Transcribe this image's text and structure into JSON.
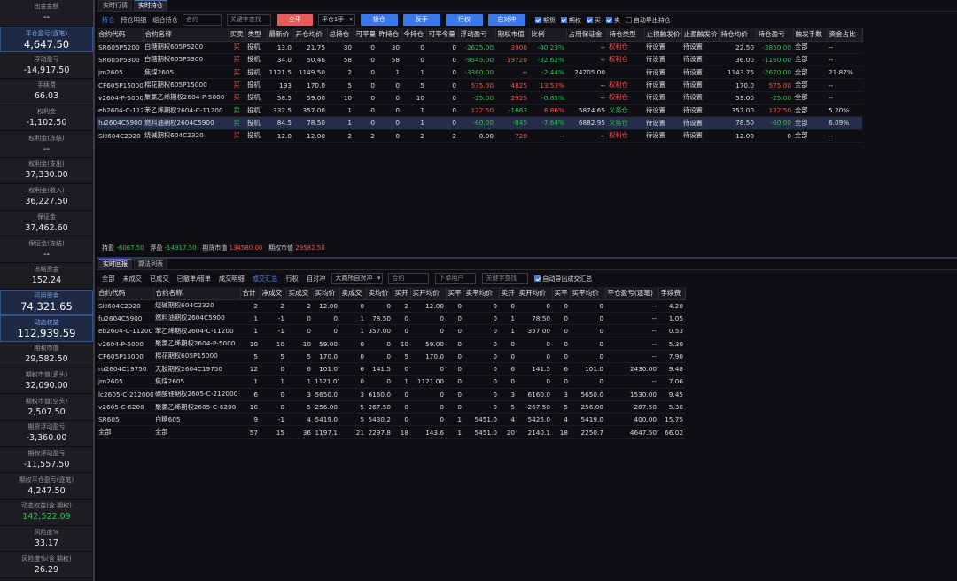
{
  "sidebar": [
    {
      "label": "出金金额",
      "value": "--",
      "hl": false,
      "color": ""
    },
    {
      "label": "平仓盈亏(逐笔)",
      "value": "4,647.50",
      "hl": true,
      "color": ""
    },
    {
      "label": "浮动盈亏",
      "value": "-14,917.50",
      "hl": false,
      "color": ""
    },
    {
      "label": "手续费",
      "value": "66.03",
      "hl": false,
      "color": ""
    },
    {
      "label": "权利金",
      "value": "-1,102.50",
      "hl": false,
      "color": ""
    },
    {
      "label": "权利金(冻结)",
      "value": "--",
      "hl": false,
      "color": ""
    },
    {
      "label": "权利金(支出)",
      "value": "37,330.00",
      "hl": false,
      "color": ""
    },
    {
      "label": "权利金(收入)",
      "value": "36,227.50",
      "hl": false,
      "color": ""
    },
    {
      "label": "保证金",
      "value": "37,462.60",
      "hl": false,
      "color": ""
    },
    {
      "label": "保证金(冻结)",
      "value": "--",
      "hl": false,
      "color": ""
    },
    {
      "label": "冻结资金",
      "value": "152.24",
      "hl": false,
      "color": ""
    },
    {
      "label": "可用资金",
      "value": "74,321.65",
      "hl": true,
      "color": ""
    },
    {
      "label": "动态权益",
      "value": "112,939.59",
      "hl": true,
      "color": ""
    },
    {
      "label": "期权市值",
      "value": "29,582.50",
      "hl": false,
      "color": ""
    },
    {
      "label": "期权市值(多头)",
      "value": "32,090.00",
      "hl": false,
      "color": ""
    },
    {
      "label": "期权市值(空头)",
      "value": "2,507.50",
      "hl": false,
      "color": ""
    },
    {
      "label": "期货浮动盈亏",
      "value": "-3,360.00",
      "hl": false,
      "color": ""
    },
    {
      "label": "期权浮动盈亏",
      "value": "-11,557.50",
      "hl": false,
      "color": ""
    },
    {
      "label": "期权平仓盈亏(逐笔)",
      "value": "4,247.50",
      "hl": false,
      "color": ""
    },
    {
      "label": "动态权益(含 期权)",
      "value": "142,522.09",
      "hl": false,
      "color": "green"
    },
    {
      "label": "风险度%",
      "value": "33.17",
      "hl": false,
      "color": ""
    },
    {
      "label": "风险度%(含 期权)",
      "value": "26.29",
      "hl": false,
      "color": ""
    }
  ],
  "top": {
    "tabs": [
      "实时行情",
      "实时持仓"
    ],
    "toolbar": {
      "segs": [
        "持仓",
        "持仓明细",
        "组合持仓"
      ],
      "contract_placeholder": "合约",
      "search_placeholder": "关键字查找",
      "btn_close_all": "全平",
      "select_value": "平仓1手",
      "btn_lock": "锁仓",
      "btn_reverse": "反手",
      "btn_exercise": "行权",
      "btn_self_hedge": "自对冲",
      "checks": [
        {
          "label": "期货",
          "on": true
        },
        {
          "label": "期权",
          "on": true
        },
        {
          "label": "买",
          "on": true
        },
        {
          "label": "卖",
          "on": true
        },
        {
          "label": "自动导出持仓",
          "on": false
        }
      ]
    },
    "columns": [
      "合约代码",
      "合约名称",
      "买卖",
      "类型",
      "最新价",
      "开仓均价",
      "总持仓",
      "可平量",
      "昨持仓",
      "今持仓",
      "可平今量",
      "浮动盈亏",
      "期权市值",
      "比例",
      "占用保证金",
      "持仓类型",
      "止损触发价",
      "止盈触发价",
      "持仓均价",
      "持仓盈亏",
      "触发手数",
      "资金占比"
    ],
    "rows": [
      [
        "SR605P5200",
        "白糖期权605P5200",
        "买",
        "投机",
        "13.0",
        "21.75",
        "30",
        "0",
        "30",
        "0",
        "0",
        "-2625.00",
        "3900",
        "-40.23%",
        "--",
        "权利仓",
        "待设置",
        "待设置",
        "22.50",
        "-2850.00",
        "全部",
        "--"
      ],
      [
        "SR605P5300",
        "白糖期权605P5300",
        "买",
        "投机",
        "34.0",
        "50.46",
        "58",
        "0",
        "58",
        "0",
        "0",
        "-9545.00",
        "19720",
        "-32.62%",
        "--",
        "权利仓",
        "待设置",
        "待设置",
        "36.00",
        "-1160.00",
        "全部",
        "--"
      ],
      [
        "jm2605",
        "焦煤2605",
        "买",
        "投机",
        "1121.5",
        "1149.50",
        "2",
        "0",
        "1",
        "1",
        "0",
        "-3360.00",
        "--",
        "-2.44%",
        "24705.00",
        "",
        "待设置",
        "待设置",
        "1143.75",
        "-2670.00",
        "全部",
        "21.87%"
      ],
      [
        "CF605P15000",
        "棉花期权605P15000",
        "买",
        "投机",
        "193",
        "170.0",
        "5",
        "0",
        "0",
        "5",
        "0",
        "575.00",
        "4825",
        "13.53%",
        "--",
        "权利仓",
        "待设置",
        "待设置",
        "170.0",
        "575.00",
        "全部",
        "--"
      ],
      [
        "v2604-P-5000",
        "聚氯乙烯期权2604-P-5000",
        "买",
        "投机",
        "58.5",
        "59.00",
        "10",
        "0",
        "0",
        "10",
        "0",
        "-25.00",
        "2925",
        "-0.85%",
        "--",
        "权利仓",
        "待设置",
        "待设置",
        "59.00",
        "-25.00",
        "全部",
        "--"
      ],
      [
        "eb2604-C-112",
        "苯乙烯期权2604-C-11200",
        "卖",
        "投机",
        "332.5",
        "357.00",
        "1",
        "0",
        "0",
        "1",
        "0",
        "122.50",
        "-1663",
        "6.86%",
        "5874.65",
        "义务仓",
        "待设置",
        "待设置",
        "357.00",
        "122.50",
        "全部",
        "5.20%"
      ],
      [
        "fu2604C5900",
        "燃料油期权2604C5900",
        "卖",
        "投机",
        "84.5",
        "78.50",
        "1",
        "0",
        "0",
        "1",
        "0",
        "-60.00",
        "-845",
        "-7.64%",
        "6882.95",
        "义务仓",
        "待设置",
        "待设置",
        "78.50",
        "-60.00",
        "全部",
        "6.09%"
      ],
      [
        "SH604C2320",
        "烧碱期权604C2320",
        "买",
        "投机",
        "12.0",
        "12.00",
        "2",
        "2",
        "0",
        "2",
        "2",
        "0.00",
        "720",
        "--",
        "--",
        "权利仓",
        "待设置",
        "待设置",
        "12.00",
        "0",
        "全部",
        "--"
      ]
    ],
    "summary": {
      "hold_profit_label": "持盈",
      "hold_profit": "-6067.50",
      "float_label": "浮盈",
      "float_value": "-14917.50",
      "fut_mv_label": "期货市值",
      "fut_mv": "134580.00",
      "opt_mv_label": "期权市值",
      "opt_mv": "29582.50"
    }
  },
  "bottom": {
    "tabs": [
      "实时回报",
      "算法列表"
    ],
    "toolbar": {
      "segs": [
        "全部",
        "未成交",
        "已成交",
        "已撤单/错单",
        "成交明细",
        "成交汇总",
        "行权",
        "自对冲"
      ],
      "active_seg": "成交汇总",
      "select_value": "大商所自对冲",
      "contract_placeholder": "合约",
      "user_placeholder": "下单用户",
      "search_placeholder": "关键字查找",
      "auto_export_label": "自动导出成交汇总"
    },
    "columns": [
      "合约代码",
      "合约名称",
      "合计",
      "净成交",
      "买成交",
      "买均价",
      "卖成交",
      "卖均价",
      "买开",
      "买开均价",
      "买平",
      "卖平均价",
      "卖开",
      "卖开均价",
      "买平",
      "买平均价",
      "平仓盈亏(逐笔)",
      "手续费"
    ],
    "rows": [
      [
        "SH604C2320",
        "烧碱期权604C2320",
        "2",
        "2",
        "2",
        "12.00",
        "0",
        "0",
        "2",
        "12.00",
        "0",
        "0",
        "0",
        "0",
        "0",
        "0",
        "--",
        "4.20"
      ],
      [
        "fu2604C5900",
        "燃料油期权2604C5900",
        "1",
        "-1",
        "0",
        "0",
        "1",
        "78.50",
        "0",
        "0",
        "0",
        "0",
        "1",
        "78.50",
        "0",
        "0",
        "--",
        "1.05"
      ],
      [
        "eb2604-C-11200",
        "苯乙烯期权2604-C-11200",
        "1",
        "-1",
        "0",
        "0",
        "1",
        "357.00",
        "0",
        "0",
        "0",
        "0",
        "1",
        "357.00",
        "0",
        "0",
        "--",
        "0.53"
      ],
      [
        "v2604-P-5000",
        "聚氯乙烯期权2604-P-5000",
        "10",
        "10",
        "10",
        "59.00",
        "0",
        "0",
        "10",
        "59.00",
        "0",
        "0",
        "0",
        "0",
        "0",
        "0",
        "--",
        "5.30"
      ],
      [
        "CF605P15000",
        "棉花期权605P15000",
        "5",
        "5",
        "5",
        "170.0",
        "0",
        "0",
        "5",
        "170.0",
        "0",
        "0",
        "0",
        "0",
        "0",
        "0",
        "--",
        "7.90"
      ],
      [
        "ru2604C19750",
        "天胶期权2604C19750",
        "12",
        "0",
        "6",
        "101.0",
        "6",
        "141.5",
        "0",
        "0",
        "0",
        "0",
        "6",
        "141.5",
        "6",
        "101.0",
        "2430.00",
        "9.48"
      ],
      [
        "jm2605",
        "焦煤2605",
        "1",
        "1",
        "1",
        "1121.00",
        "0",
        "0",
        "1",
        "1121.00",
        "0",
        "0",
        "0",
        "0",
        "0",
        "0",
        "--",
        "7.06"
      ],
      [
        "lc2605-C-212000",
        "碳酸锂期权2605-C-212000",
        "6",
        "0",
        "3",
        "5650.0",
        "3",
        "6160.0",
        "0",
        "0",
        "0",
        "0",
        "3",
        "6160.0",
        "3",
        "5650.0",
        "1530.00",
        "9.45"
      ],
      [
        "v2605-C-6200",
        "聚氯乙烯期权2605-C-6200",
        "10",
        "0",
        "5",
        "256.00",
        "5",
        "267.50",
        "0",
        "0",
        "0",
        "0",
        "5",
        "267.50",
        "5",
        "256.00",
        "287.50",
        "5.30"
      ],
      [
        "SR605",
        "白糖605",
        "9",
        "-1",
        "4",
        "5419.0",
        "5",
        "5430.2",
        "0",
        "0",
        "1",
        "5451.0",
        "4",
        "5425.0",
        "4",
        "5419.0",
        "400.00",
        "15.75"
      ],
      [
        "全部",
        "全部",
        "57",
        "15",
        "36",
        "1197.1",
        "21",
        "2297.8",
        "18",
        "143.6",
        "1",
        "5451.0",
        "20",
        "2140.1",
        "18",
        "2250.7",
        "4647.50",
        "66.02"
      ]
    ]
  },
  "colors": {
    "up": "#ff4d4d",
    "down": "#28c250",
    "accent": "#3a78e8",
    "danger_btn": "#e95a5a"
  }
}
